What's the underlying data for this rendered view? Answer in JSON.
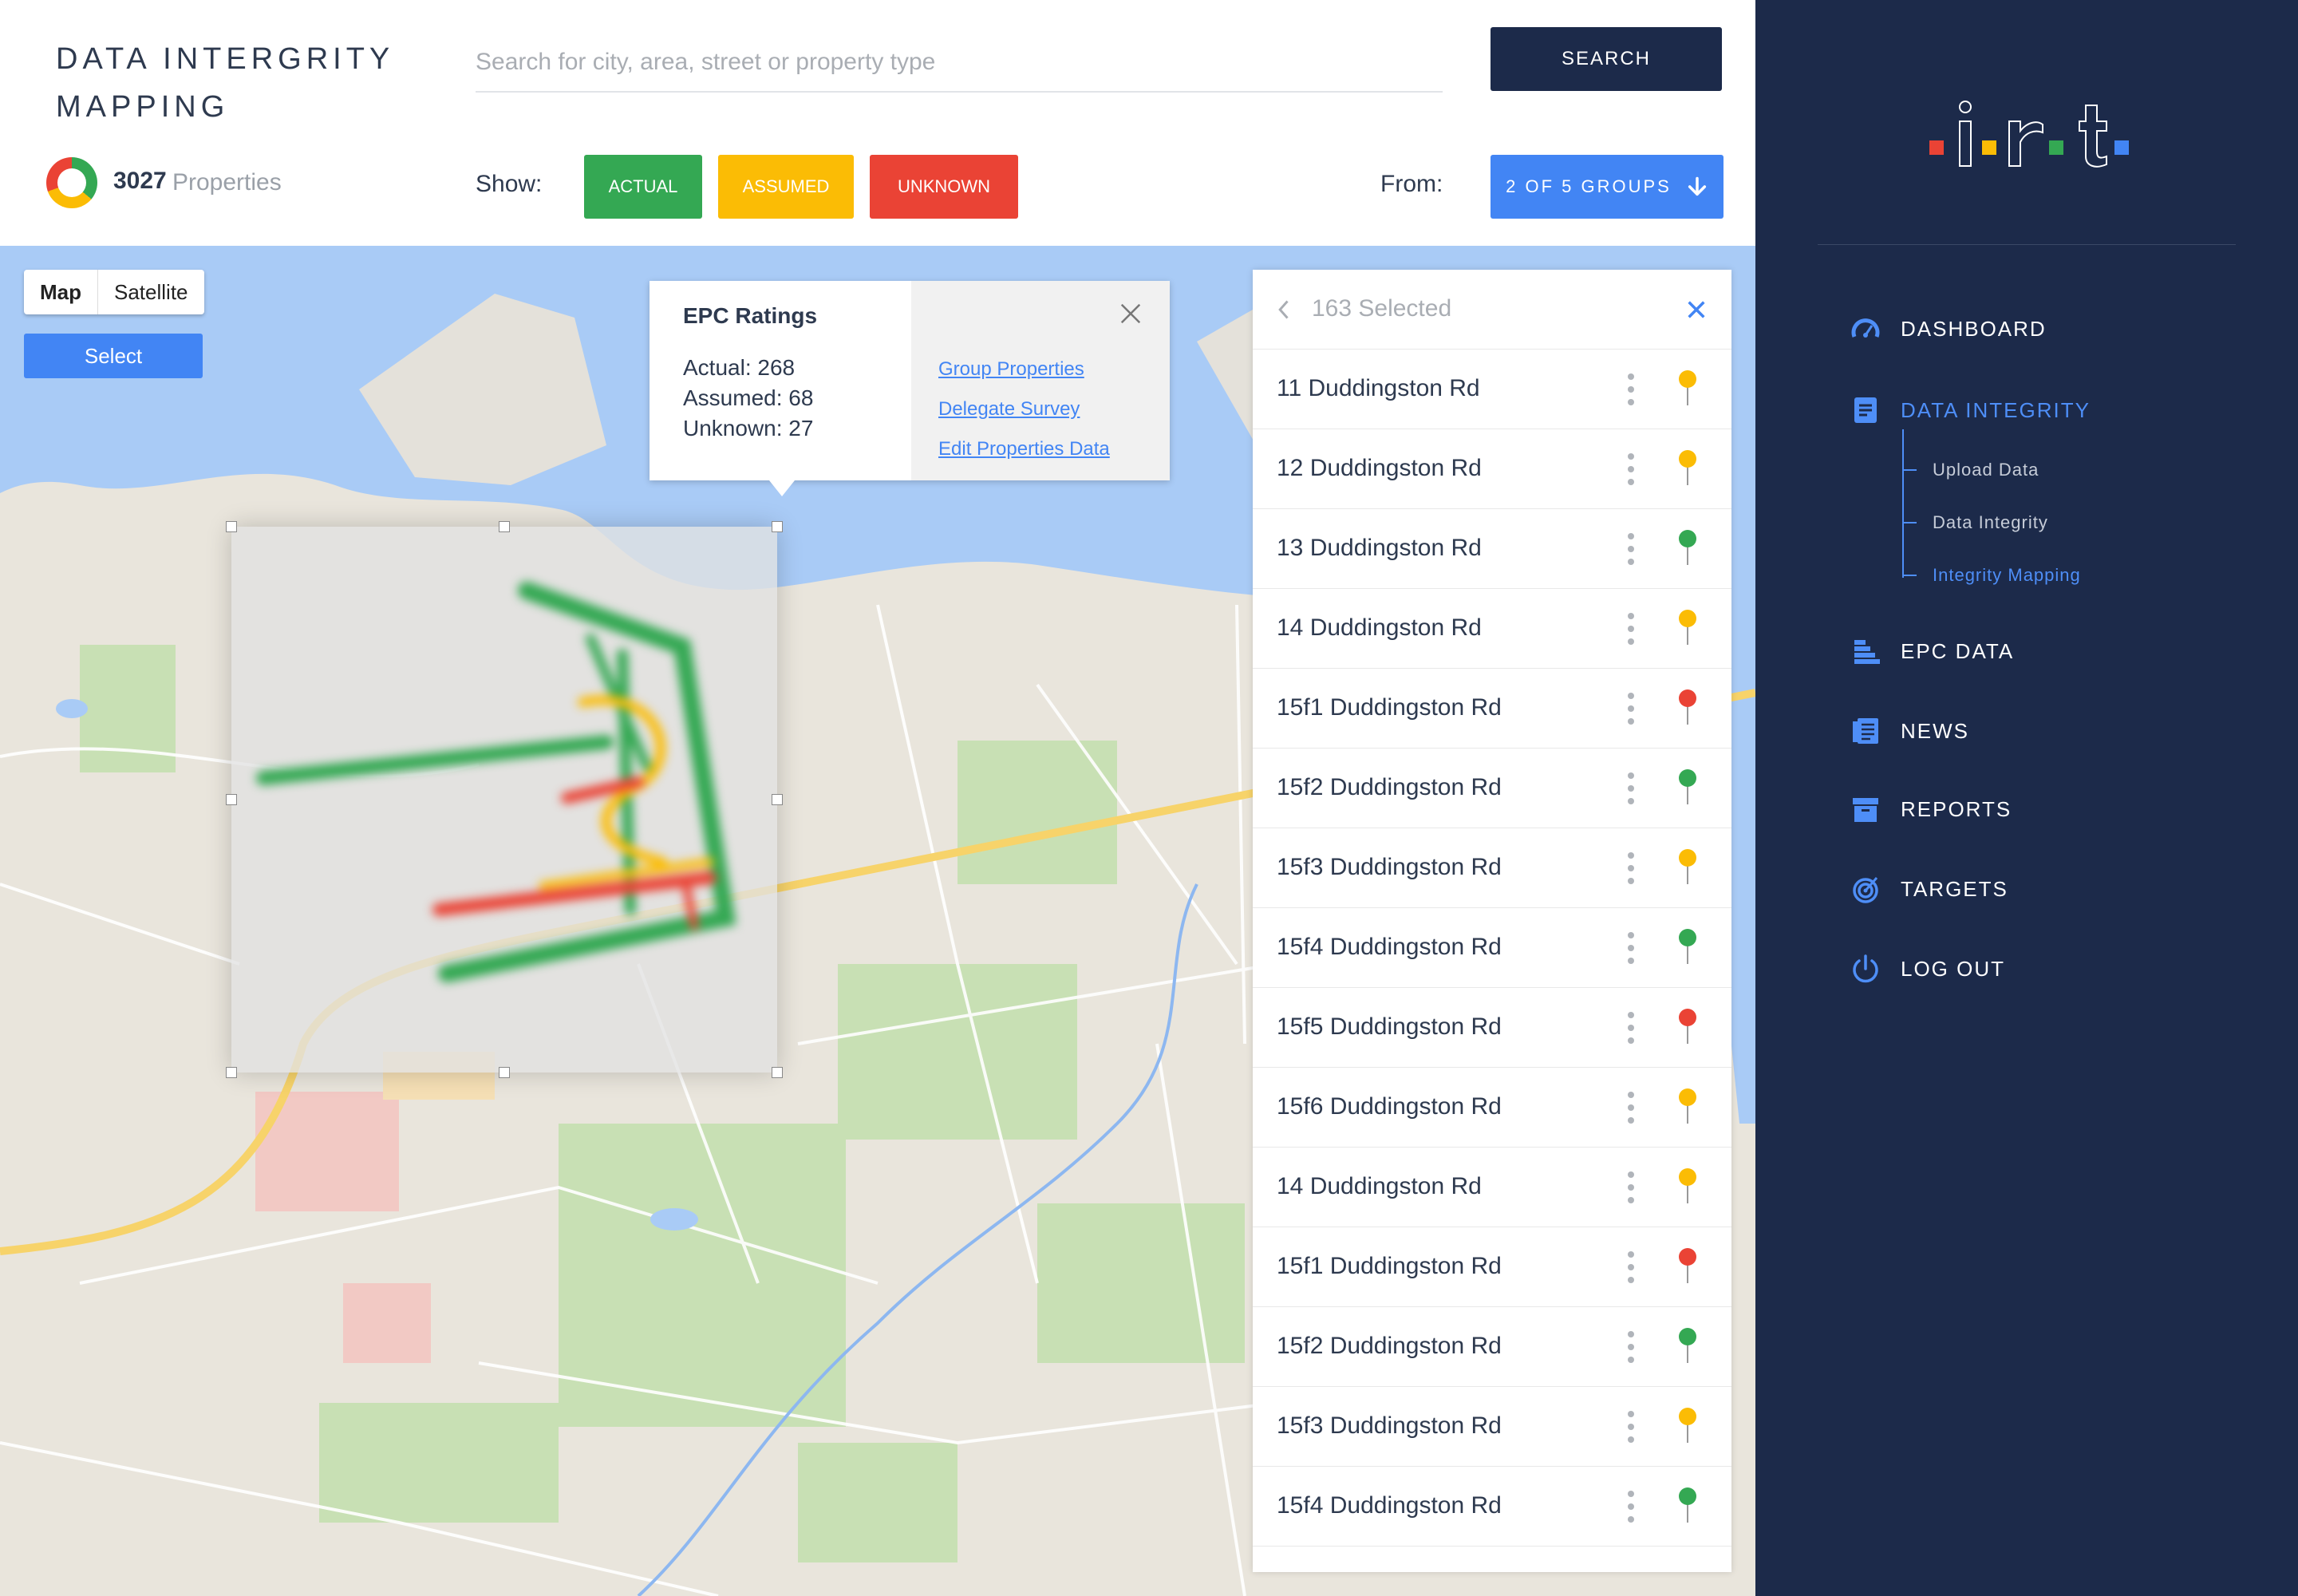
{
  "header": {
    "title": "DATA INTERGRITY MAPPING",
    "property_count": "3027",
    "property_label": "Properties",
    "search_placeholder": "Search for city, area, street or property type",
    "search_button": "SEARCH",
    "show_label": "Show:",
    "filters": {
      "actual": "ACTUAL",
      "assumed": "ASSUMED",
      "unknown": "UNKNOWN"
    },
    "from_label": "From:",
    "groups_button": "2 OF 5 GROUPS"
  },
  "colors": {
    "actual": "#34a853",
    "assumed": "#fbbc05",
    "unknown": "#ea4335",
    "primary": "#4285f4",
    "navy": "#1c2a4a"
  },
  "map": {
    "toggle": {
      "map": "Map",
      "satellite": "Satellite"
    },
    "select_button": "Select"
  },
  "popup": {
    "title": "EPC Ratings",
    "actual": "Actual: 268",
    "assumed": "Assumed: 68",
    "unknown": "Unknown: 27",
    "links": {
      "group": "Group Properties",
      "delegate": "Delegate Survey",
      "edit": "Edit Properties Data"
    }
  },
  "selection": {
    "count": "163 Selected",
    "rows": [
      {
        "label": "11 Duddingston Rd",
        "status": "assumed"
      },
      {
        "label": "12 Duddingston Rd",
        "status": "assumed"
      },
      {
        "label": "13 Duddingston Rd",
        "status": "actual"
      },
      {
        "label": "14 Duddingston Rd",
        "status": "assumed"
      },
      {
        "label": "15f1 Duddingston Rd",
        "status": "unknown"
      },
      {
        "label": "15f2 Duddingston Rd",
        "status": "actual"
      },
      {
        "label": "15f3 Duddingston Rd",
        "status": "assumed"
      },
      {
        "label": "15f4 Duddingston Rd",
        "status": "actual"
      },
      {
        "label": "15f5 Duddingston Rd",
        "status": "unknown"
      },
      {
        "label": "15f6 Duddingston Rd",
        "status": "assumed"
      },
      {
        "label": "14 Duddingston Rd",
        "status": "assumed"
      },
      {
        "label": "15f1 Duddingston Rd",
        "status": "unknown"
      },
      {
        "label": "15f2 Duddingston Rd",
        "status": "actual"
      },
      {
        "label": "15f3 Duddingston Rd",
        "status": "assumed"
      },
      {
        "label": "15f4 Duddingston Rd",
        "status": "actual"
      }
    ]
  },
  "sidebar": {
    "items": [
      {
        "label": "DASHBOARD",
        "icon": "gauge-icon"
      },
      {
        "label": "DATA INTEGRITY",
        "icon": "document-icon"
      },
      {
        "label": "EPC DATA",
        "icon": "bar-chart-icon"
      },
      {
        "label": "NEWS",
        "icon": "newspaper-icon"
      },
      {
        "label": "REPORTS",
        "icon": "archive-box-icon"
      },
      {
        "label": "TARGETS",
        "icon": "target-icon"
      },
      {
        "label": "LOG OUT",
        "icon": "power-icon"
      }
    ],
    "sub_items": [
      {
        "label": "Upload Data"
      },
      {
        "label": "Data Integrity"
      },
      {
        "label": "Integrity Mapping"
      }
    ]
  }
}
